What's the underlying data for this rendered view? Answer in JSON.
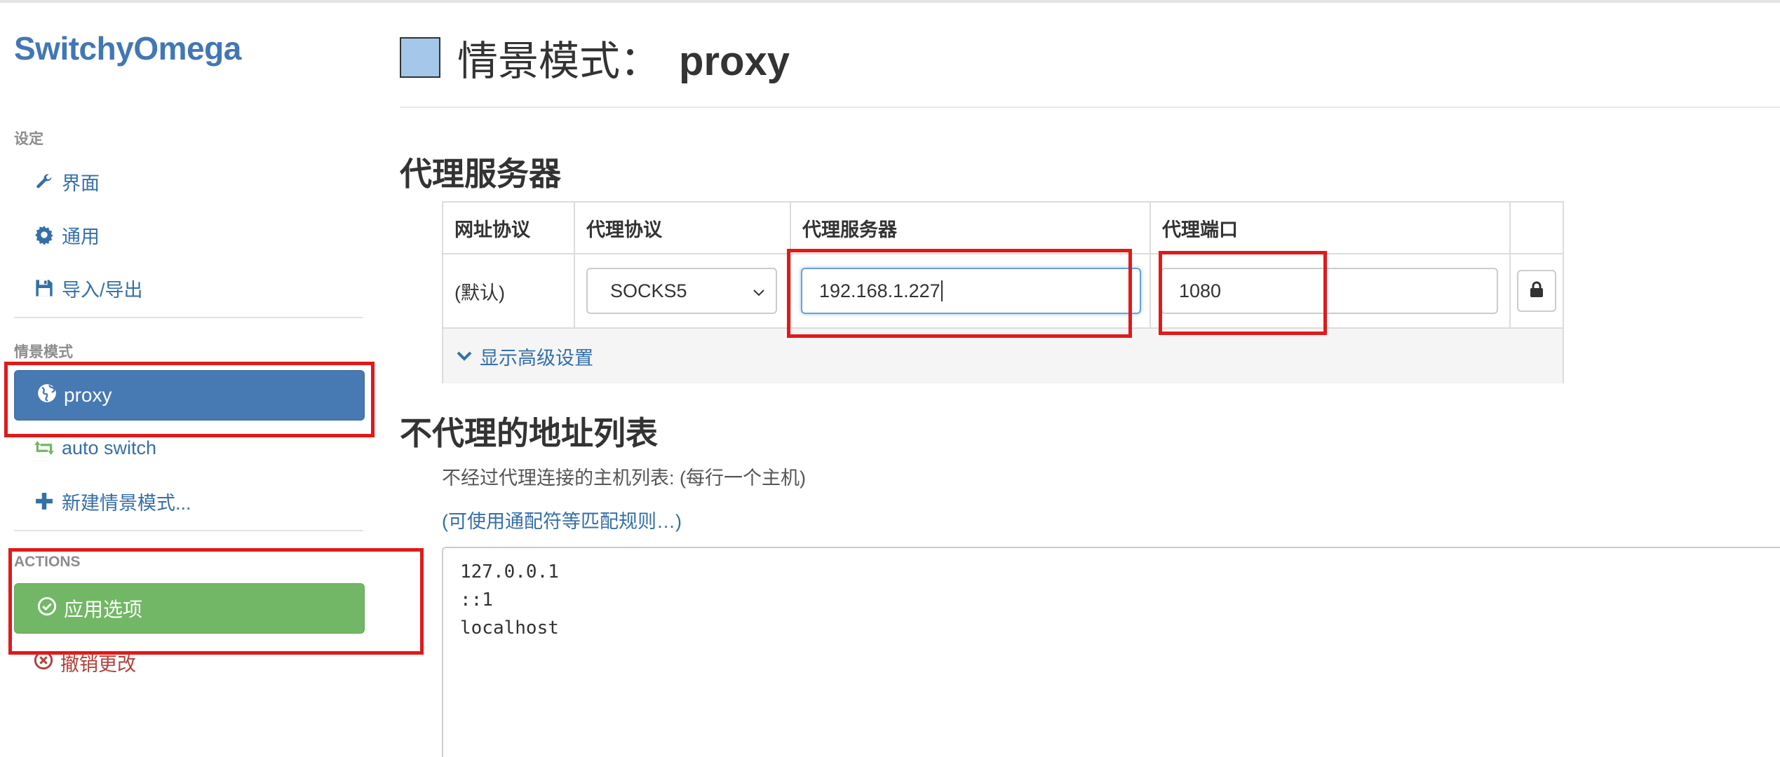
{
  "sidebar": {
    "brand": "SwitchyOmega",
    "settings_header": "设定",
    "settings_items": [
      {
        "label": "界面",
        "icon": "wrench-icon"
      },
      {
        "label": "通用",
        "icon": "gear-icon"
      },
      {
        "label": "导入/导出",
        "icon": "save-icon"
      }
    ],
    "profiles_header": "情景模式",
    "profiles": [
      {
        "label": "proxy",
        "icon": "globe-icon",
        "active": true
      },
      {
        "label": "auto switch",
        "icon": "retweet-icon",
        "active": false
      }
    ],
    "new_profile": "新建情景模式...",
    "actions_header": "ACTIONS",
    "apply_label": "应用选项",
    "revert_label": "撤销更改"
  },
  "main": {
    "title_prefix": "情景模式：",
    "profile_name": "proxy",
    "profile_color": "#a4c7ea",
    "proxy_section_title": "代理服务器",
    "table": {
      "headers": [
        "网址协议",
        "代理协议",
        "代理服务器",
        "代理端口"
      ],
      "row": {
        "scheme": "(默认)",
        "protocol": "SOCKS5",
        "server": "192.168.1.227",
        "port": "1080"
      },
      "advanced_toggle": "显示高级设置"
    },
    "bypass_section_title": "不代理的地址列表",
    "bypass_help": "不经过代理连接的主机列表: (每行一个主机)",
    "bypass_link": "(可使用通配符等匹配规则…)",
    "bypass_list": "127.0.0.1\n::1\nlocalhost"
  },
  "colors": {
    "accent": "#4277b5",
    "active_pill": "#4779b2",
    "apply": "#72b765",
    "danger": "#b0413b",
    "annotation": "#e01a1a"
  }
}
